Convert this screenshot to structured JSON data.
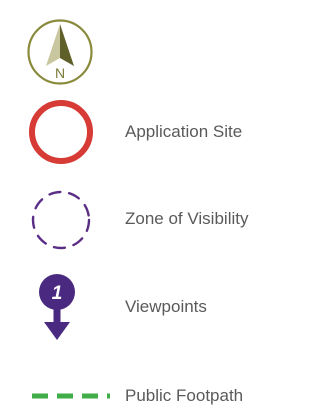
{
  "legend": {
    "north_arrow": {
      "letter": "N",
      "icon": "north-arrow-icon",
      "color": "#8a8a3c"
    },
    "items": [
      {
        "label": "Application Site",
        "icon": "red-circle-icon",
        "color": "#d63b35"
      },
      {
        "label": "Zone of Visibility",
        "icon": "dashed-circle-icon",
        "color": "#5b2e86"
      },
      {
        "label": "Viewpoints",
        "icon": "viewpoint-marker-icon",
        "color": "#4a2a80",
        "marker_number": "1"
      },
      {
        "label": "Public Footpath",
        "icon": "dashed-line-icon",
        "color": "#3fae49"
      }
    ]
  }
}
